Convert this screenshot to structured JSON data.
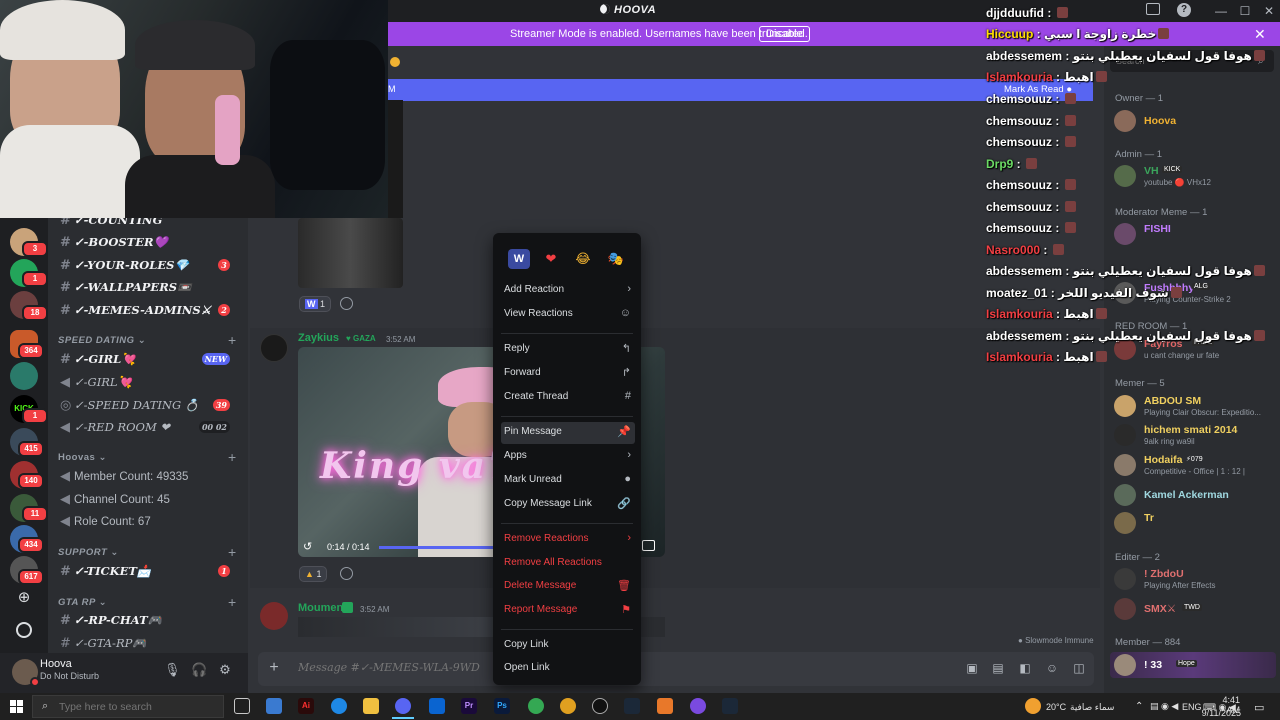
{
  "window": {
    "title": "HOOVA"
  },
  "banner": {
    "text": "Streamer Mode is enabled. Usernames have been truncated.",
    "button": "Disable"
  },
  "channels": {
    "items": [
      {
        "name": "✓-COUNTING",
        "badge": ""
      },
      {
        "name": "✓-BOOSTER💜",
        "badge": ""
      },
      {
        "name": "✓-YOUR-ROLES💎",
        "badge": "3"
      },
      {
        "name": "✓-WALLPAPERS📼",
        "badge": ""
      },
      {
        "name": "✓-MEMES-ADMINS⚔",
        "badge": "2"
      }
    ],
    "cat_speed": "SPEED DATING",
    "speed": [
      {
        "name": "✓-GIRL💘",
        "badge": "NEW"
      },
      {
        "name": "✓-GIRL💘",
        "badge": ""
      },
      {
        "name": "✓-SPEED DATING 💍",
        "badge": "39"
      },
      {
        "name": "✓-RED ROOM ❤",
        "badge": "00  02"
      }
    ],
    "cat_hoovas": "Hoovas",
    "hoovas": [
      "Member Count: 49335",
      "Channel Count: 45",
      "Role Count: 67"
    ],
    "cat_support": "SUPPORT",
    "support": [
      {
        "name": "✓-TICKET📩",
        "badge": "1"
      }
    ],
    "cat_gta": "GTA RP",
    "gta": [
      "✓-RP-CHAT🎮",
      "✓-GTA-RP🎮"
    ]
  },
  "rail_badges": [
    "3",
    "1",
    "18",
    "364",
    "1",
    "415",
    "140",
    "11",
    "434",
    "617"
  ],
  "user": {
    "name": "Hoova",
    "status": "Do Not Disturb"
  },
  "mark_read": "Mark As Read",
  "messages": [
    {
      "user": "Zaykius",
      "tag": "GAZA",
      "time": "3:52 AM",
      "video_time": "0:14 / 0:14",
      "video_text": "King va7di",
      "reaction_count": "1"
    },
    {
      "user": "Moumen",
      "time": "3:52 AM"
    }
  ],
  "prev_reaction_count": "1",
  "composer": {
    "placeholder": "Message #✓-MEMES-WLA-9WD"
  },
  "slowmode": "Slowmode Immune",
  "context_menu": {
    "quick": [
      "W",
      "❤",
      "😂",
      "🎭"
    ],
    "items": [
      {
        "label": "Add Reaction",
        "icon": "›",
        "danger": false
      },
      {
        "label": "View Reactions",
        "icon": "☺",
        "danger": false
      },
      {
        "label": "Reply",
        "icon": "↰",
        "danger": false
      },
      {
        "label": "Forward",
        "icon": "↱",
        "danger": false
      },
      {
        "label": "Create Thread",
        "icon": "#",
        "danger": false
      },
      {
        "label": "Pin Message",
        "icon": "📌",
        "danger": false
      },
      {
        "label": "Apps",
        "icon": "›",
        "danger": false
      },
      {
        "label": "Mark Unread",
        "icon": "●",
        "danger": false
      },
      {
        "label": "Copy Message Link",
        "icon": "🔗",
        "danger": false
      },
      {
        "label": "Remove Reactions",
        "icon": "›",
        "danger": true
      },
      {
        "label": "Remove All Reactions",
        "icon": "",
        "danger": true
      },
      {
        "label": "Delete Message",
        "icon": "🗑",
        "danger": true
      },
      {
        "label": "Report Message",
        "icon": "⚑",
        "danger": true
      },
      {
        "label": "Copy Link",
        "icon": "",
        "danger": false
      },
      {
        "label": "Open Link",
        "icon": "",
        "danger": false
      }
    ]
  },
  "overlay_chat": [
    {
      "name": "djjdduufid",
      "msg": ""
    },
    {
      "name": "Hiccuup",
      "msg": "خطرة زاوجة ا سبي"
    },
    {
      "name": "abdessemem",
      "msg": "هوفا قول لسفيان يعطيلي بنتو"
    },
    {
      "name": "Islamkouria",
      "msg": "اهبط"
    },
    {
      "name": "chemsouuz",
      "msg": ""
    },
    {
      "name": "chemsouuz",
      "msg": ""
    },
    {
      "name": "chemsouuz",
      "msg": ""
    },
    {
      "name": "Drp9",
      "msg": ""
    },
    {
      "name": "chemsouuz",
      "msg": ""
    },
    {
      "name": "chemsouuz",
      "msg": ""
    },
    {
      "name": "chemsouuz",
      "msg": ""
    },
    {
      "name": "Nasro000",
      "msg": ""
    },
    {
      "name": "abdessemem",
      "msg": "هوفا قول لسفيان يعطيلي بنتو"
    },
    {
      "name": "moatez_01",
      "msg": "شوف الفيديو اللخر"
    },
    {
      "name": "Islamkouria",
      "msg": "اهبط"
    },
    {
      "name": "abdessemem",
      "msg": "هوفا قول لسفيان يعطيلي بنتو"
    },
    {
      "name": "Islamkouria",
      "msg": "اهبط"
    }
  ],
  "members": {
    "search_placeholder": "Search",
    "roles": {
      "owner": "Owner — 1",
      "admin": "Admin — 1",
      "moderator": "Moderator Meme — 1",
      "redroom": "RED ROOM — 1",
      "memer": "Memer — 5",
      "editer": "Editer — 2",
      "member": "Member — 884"
    },
    "list": {
      "hoova": {
        "name": "Hoova",
        "status": ""
      },
      "vh": {
        "name": "VH",
        "tag": "KICK",
        "status": "youtube 🔴 VHx12"
      },
      "fishi": {
        "name": "FISHI",
        "status": ""
      },
      "fushhhy": {
        "name": "Fushhhhy",
        "tag": "ALG",
        "status": "Playing Counter-Strike 2"
      },
      "fayrros": {
        "name": "Fayrros",
        "tag": "FADE",
        "status": "u cant change ur fate"
      },
      "abdou": {
        "name": "ABDOU SM",
        "status": "Playing Clair Obscur: Expeditio..."
      },
      "hichem": {
        "name": "hichem smati 2014",
        "status": "9alk ring wa9il"
      },
      "hodaifa": {
        "name": "Hodaifa",
        "tag": "079",
        "status": "Competitive - Office | 1 : 12 |"
      },
      "kamel": {
        "name": "Kamel Ackerman",
        "status": ""
      },
      "tr": {
        "name": "Tr",
        "status": ""
      },
      "zbdou": {
        "name": "! ZbdoU",
        "status": "Playing After Effects"
      },
      "smx": {
        "name": "SMX⚔",
        "tag": "TWD",
        "status": ""
      },
      "m33": {
        "name": "! 33",
        "tag": "Hope",
        "status": ""
      }
    }
  },
  "taskbar": {
    "search_placeholder": "Type here to search",
    "weather": "20°C",
    "weather_text": "سماء صافية",
    "lang": "ENG",
    "time": "4:41 AM",
    "date": "9/11/2025"
  },
  "colors": {
    "accent": "#5865f2",
    "banner": "#9b46e6",
    "danger": "#f23f43",
    "online": "#23a55a"
  }
}
